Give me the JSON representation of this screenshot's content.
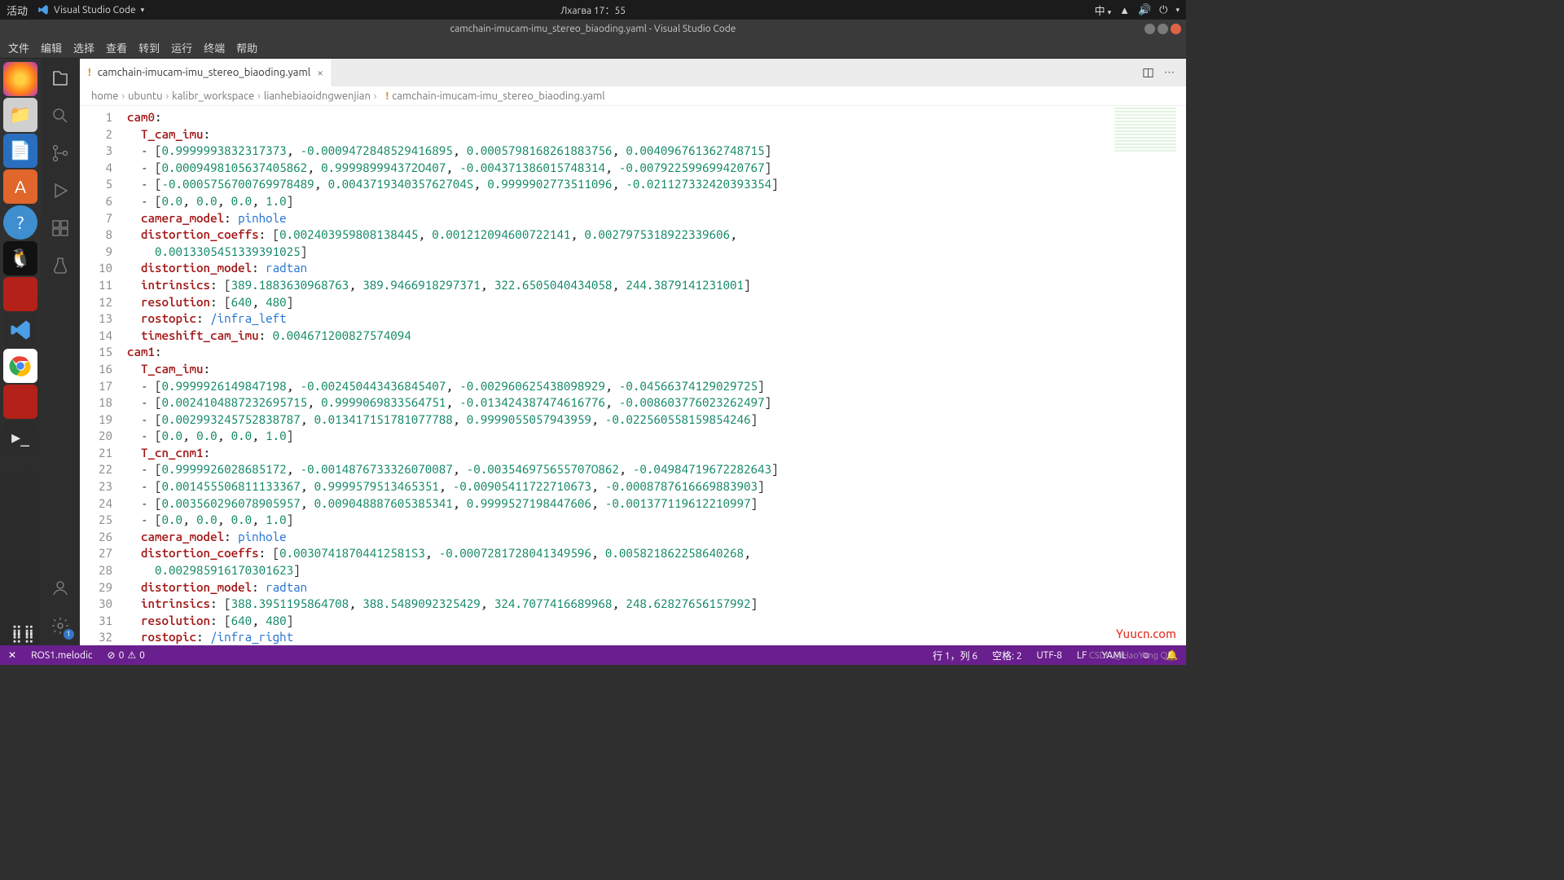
{
  "gnome": {
    "activities": "活动",
    "app": "Visual Studio Code",
    "clock": "Лхагва 17：55",
    "ime": "中"
  },
  "title": "camchain-imucam-imu_stereo_biaoding.yaml - Visual Studio Code",
  "menu": [
    "文件",
    "编辑",
    "选择",
    "查看",
    "转到",
    "运行",
    "终端",
    "帮助"
  ],
  "tab": {
    "name": "camchain-imucam-imu_stereo_biaoding.yaml"
  },
  "breadcrumbs": [
    "home",
    "ubuntu",
    "kalibr_workspace",
    "lianhebiaoidngwenjian",
    "camchain-imucam-imu_stereo_biaoding.yaml"
  ],
  "code": [
    {
      "t": "key",
      "indent": 0,
      "text": "cam0:"
    },
    {
      "t": "key",
      "indent": 1,
      "text": "T_cam_imu:"
    },
    {
      "t": "arr",
      "indent": 1,
      "vals": [
        "0.9999993832317373",
        "-0.0009472848529416895",
        "0.0005798168261883756",
        "0.004096761362748715"
      ]
    },
    {
      "t": "arr",
      "indent": 1,
      "vals": [
        "0.0009498105637405862",
        "0.999989994372O407",
        "-0.004371386015748314",
        "-0.007922599699420767"
      ]
    },
    {
      "t": "arr",
      "indent": 1,
      "vals": [
        "-0.0005756700769978489",
        "0.004371934035762704S",
        "0.9999902773511096",
        "-0.021127332420393354"
      ]
    },
    {
      "t": "arr",
      "indent": 1,
      "vals": [
        "0.0",
        "0.0",
        "0.0",
        "1.0"
      ]
    },
    {
      "t": "kv",
      "indent": 1,
      "key": "camera_model",
      "val": "pinhole",
      "vc": "blue"
    },
    {
      "t": "klist",
      "indent": 1,
      "key": "distortion_coeffs",
      "vals": [
        "0.002403959808138445",
        "0.001212094600722141",
        "0.0027975318922339606",
        ""
      ]
    },
    {
      "t": "cont",
      "indent": 2,
      "vals": [
        "0.0013305451339391025"
      ]
    },
    {
      "t": "kv",
      "indent": 1,
      "key": "distortion_model",
      "val": "radtan",
      "vc": "blue"
    },
    {
      "t": "klist",
      "indent": 1,
      "key": "intrinsics",
      "vals": [
        "389.1883630968763",
        "389.9466918297371",
        "322.6505040434058",
        "244.3879141231001"
      ]
    },
    {
      "t": "klist",
      "indent": 1,
      "key": "resolution",
      "vals": [
        "640",
        "480"
      ]
    },
    {
      "t": "kv",
      "indent": 1,
      "key": "rostopic",
      "val": "/infra_left",
      "vc": "blue"
    },
    {
      "t": "kv",
      "indent": 1,
      "key": "timeshift_cam_imu",
      "val": "0.004671200827574094",
      "vc": "green"
    },
    {
      "t": "key",
      "indent": 0,
      "text": "cam1:"
    },
    {
      "t": "key",
      "indent": 1,
      "text": "T_cam_imu:"
    },
    {
      "t": "arr",
      "indent": 1,
      "vals": [
        "0.9999926149847198",
        "-0.002450443436845407",
        "-0.002960625438098929",
        "-0.04566374129029725"
      ]
    },
    {
      "t": "arr",
      "indent": 1,
      "vals": [
        "0.0024104887232695715",
        "0.9999069833564751",
        "-0.013424387474616776",
        "-0.008603776023262497"
      ]
    },
    {
      "t": "arr",
      "indent": 1,
      "vals": [
        "0.002993245752838787",
        "0.013417151781077788",
        "0.9999055057943959",
        "-0.022560558159854246"
      ]
    },
    {
      "t": "arr",
      "indent": 1,
      "vals": [
        "0.0",
        "0.0",
        "0.0",
        "1.0"
      ]
    },
    {
      "t": "key",
      "indent": 1,
      "text": "T_cn_cnm1:"
    },
    {
      "t": "arr",
      "indent": 1,
      "vals": [
        "0.9999926028685172",
        "-0.0014876733326070087",
        "-0.003546975655707O862",
        "-0.04984719672282643"
      ]
    },
    {
      "t": "arr",
      "indent": 1,
      "vals": [
        "0.001455506811133367",
        "0.9999579513465351",
        "-0.00905411722710673",
        "-0.0008787616669883903"
      ]
    },
    {
      "t": "arr",
      "indent": 1,
      "vals": [
        "0.003560296078905957",
        "0.009048887605385341",
        "0.9999527198447606",
        "-0.001377119612210997"
      ]
    },
    {
      "t": "arr",
      "indent": 1,
      "vals": [
        "0.0",
        "0.0",
        "0.0",
        "1.0"
      ]
    },
    {
      "t": "kv",
      "indent": 1,
      "key": "camera_model",
      "val": "pinhole",
      "vc": "blue"
    },
    {
      "t": "klist",
      "indent": 1,
      "key": "distortion_coeffs",
      "vals": [
        "0.00307418704412581S3",
        "-0.0007281728041349596",
        "0.005821862258640268",
        ""
      ]
    },
    {
      "t": "cont",
      "indent": 2,
      "vals": [
        "0.002985916170301623"
      ]
    },
    {
      "t": "kv",
      "indent": 1,
      "key": "distortion_model",
      "val": "radtan",
      "vc": "blue"
    },
    {
      "t": "klist",
      "indent": 1,
      "key": "intrinsics",
      "vals": [
        "388.3951195864708",
        "388.5489092325429",
        "324.7077416689968",
        "248.62827656157992"
      ]
    },
    {
      "t": "klist",
      "indent": 1,
      "key": "resolution",
      "vals": [
        "640",
        "480"
      ]
    },
    {
      "t": "kv",
      "indent": 1,
      "key": "rostopic",
      "val": "/infra_right",
      "vc": "blue"
    }
  ],
  "status": {
    "ros": "ROS1.melodic",
    "errors": "0",
    "warnings": "0",
    "pos": "行 1，列 6",
    "spaces": "空格: 2",
    "encoding": "UTF-8",
    "eol": "LF",
    "lang": "YAML",
    "bell": "🔔"
  },
  "watermark": "Yuucn.com",
  "watermark2": "CSDN @HaoYang Qiu"
}
